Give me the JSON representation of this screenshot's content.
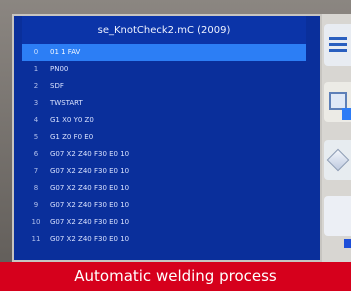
{
  "screen": {
    "title": "se_KnotCheck2.mC (2009)",
    "program_rows": [
      {
        "num": "0",
        "code": "01 1 FAV"
      },
      {
        "num": "1",
        "code": "PN00"
      },
      {
        "num": "2",
        "code": "SDF"
      },
      {
        "num": "3",
        "code": "TWSTART"
      },
      {
        "num": "4",
        "code": "G1 X0 Y0 Z0"
      },
      {
        "num": "5",
        "code": "G1 Z0 F0 E0"
      },
      {
        "num": "6",
        "code": "G07 X2 Z40 F30 E0 10"
      },
      {
        "num": "7",
        "code": "G07 X2 Z40 F30 E0 10"
      },
      {
        "num": "8",
        "code": "G07 X2 Z40 F30 E0 10"
      },
      {
        "num": "9",
        "code": "G07 X2 Z40 F30 E0 10"
      },
      {
        "num": "10",
        "code": "G07 X2 Z40 F30 E0 10"
      },
      {
        "num": "11",
        "code": "G07 X2 Z40 F30 E0 10"
      }
    ]
  },
  "caption": "Automatic welding process"
}
